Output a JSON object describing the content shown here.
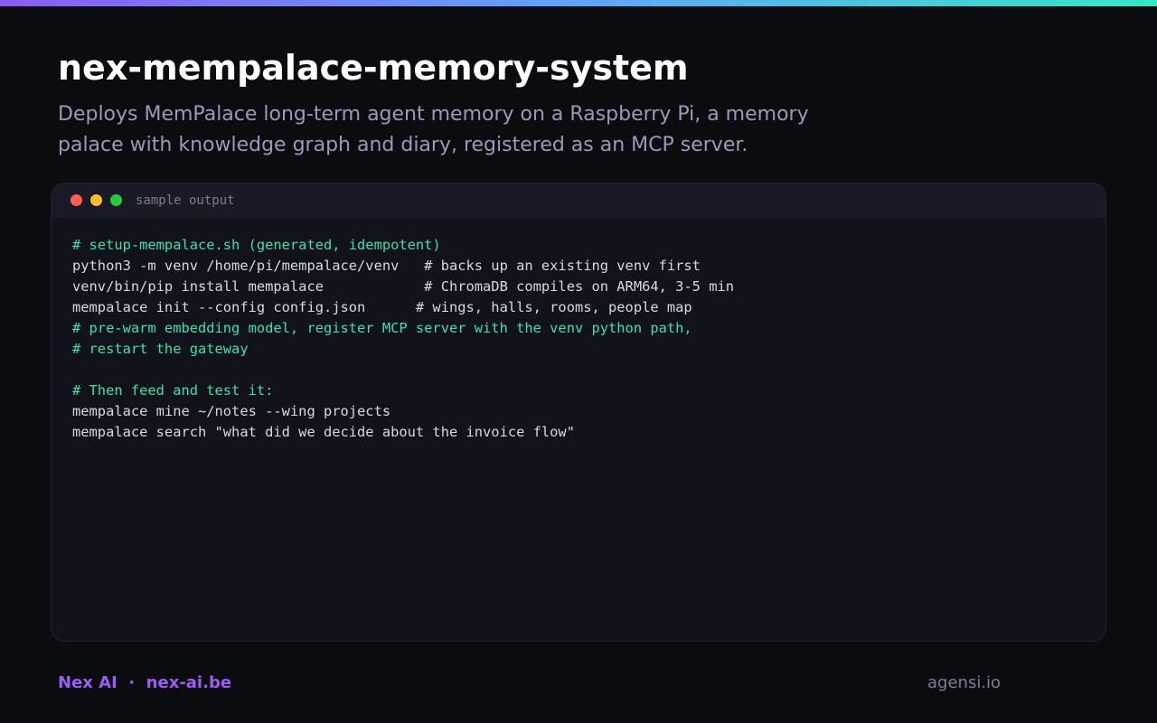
{
  "header": {
    "title": "nex-mempalace-memory-system",
    "description": "Deploys MemPalace long-term agent memory on a Raspberry Pi, a memory palace with knowledge graph and diary, registered as an MCP server."
  },
  "terminal": {
    "title": "sample output",
    "lines": [
      {
        "type": "comment",
        "text": "# setup-mempalace.sh (generated, idempotent)"
      },
      {
        "type": "cmd",
        "text": "python3 -m venv /home/pi/mempalace/venv   # backs up an existing venv first"
      },
      {
        "type": "cmd",
        "text": "venv/bin/pip install mempalace            # ChromaDB compiles on ARM64, 3-5 min"
      },
      {
        "type": "cmd",
        "text": "mempalace init --config config.json      # wings, halls, rooms, people map"
      },
      {
        "type": "comment",
        "text": "# pre-warm embedding model, register MCP server with the venv python path,"
      },
      {
        "type": "comment",
        "text": "# restart the gateway"
      },
      {
        "type": "blank",
        "text": ""
      },
      {
        "type": "comment",
        "text": "# Then feed and test it:"
      },
      {
        "type": "cmd",
        "text": "mempalace mine ~/notes --wing projects"
      },
      {
        "type": "cmd",
        "text": "mempalace search \"what did we decide about the invoice flow\""
      }
    ]
  },
  "footer": {
    "brand": "Nex AI  ·  nex-ai.be",
    "site": "agensi.io"
  },
  "colors": {
    "accent": "#9d5cf5",
    "comment": "#3ee0b0",
    "background": "#0b0c10"
  }
}
